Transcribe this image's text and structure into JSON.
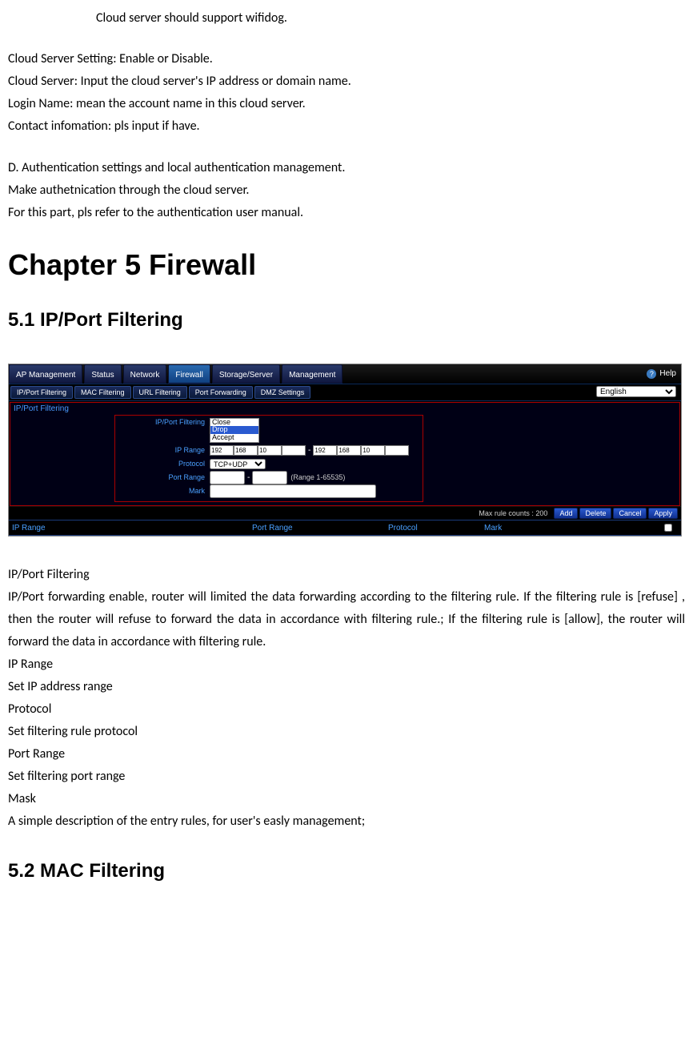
{
  "intro": {
    "line1": "Cloud server should support wifidog.",
    "line2": "Cloud Server Setting: Enable or Disable.",
    "line3": "Cloud Server: Input the cloud server's IP address or domain name.",
    "line4": "Login Name: mean the account name in this cloud server.",
    "line5": "Contact infomation: pls input if have.",
    "line6": "D. Authentication settings and local authentication management.",
    "line7": "Make authetnication through the cloud server.",
    "line8": "For this part, pls refer to the authentication user manual."
  },
  "heading_chapter": "Chapter 5 Firewall",
  "heading_51": "5.1  IP/Port Filtering",
  "heading_52": "5.2  MAC Filtering",
  "shot": {
    "tabs": {
      "ap": "AP Management",
      "status": "Status",
      "network": "Network",
      "firewall": "Firewall",
      "storage": "Storage/Server",
      "management": "Management"
    },
    "help": "Help",
    "subtabs": {
      "ipport": "IP/Port Filtering",
      "mac": "MAC Filtering",
      "url": "URL Filtering",
      "portfw": "Port Forwarding",
      "dmz": "DMZ Settings"
    },
    "lang_option": "English",
    "panel_title": "IP/Port Filtering",
    "labels": {
      "filtering": "IP/Port Filtering",
      "iprange": "IP Range",
      "protocol": "Protocol",
      "portrange": "Port Range",
      "mark": "Mark"
    },
    "dropdown": {
      "close": "Close",
      "drop": "Drop",
      "accept": "Accept"
    },
    "ip": {
      "a1": "192",
      "a2": "168",
      "a3": "10",
      "a4": "",
      "b1": "192",
      "b2": "168",
      "b3": "10",
      "b4": ""
    },
    "protocol_value": "TCP+UDP",
    "port_hint": "(Range 1-65535)",
    "max_rule": "Max rule counts : 200",
    "buttons": {
      "add": "Add",
      "delete": "Delete",
      "cancel": "Cancel",
      "apply": "Apply"
    },
    "tbl": {
      "c1": "IP Range",
      "c2": "Port Range",
      "c3": "Protocol",
      "c4": "Mark"
    }
  },
  "body": {
    "p1": "IP/Port Filtering",
    "p2": "IP/Port forwarding enable, router will limited the data forwarding according to the filtering rule. If the filtering rule is [refuse] , then the router will refuse to forward the data in accordance with filtering rule.; If the filtering rule is [allow], the router will forward the data in accordance with filtering rule.",
    "p3": "IP Range",
    "p4": "Set IP address range",
    "p5": "Protocol",
    "p6": "Set filtering rule protocol",
    "p7": "Port Range",
    "p8": "Set filtering port range",
    "p9": "Mask",
    "p10": "A simple description of the entry rules, for user's easly management;"
  }
}
